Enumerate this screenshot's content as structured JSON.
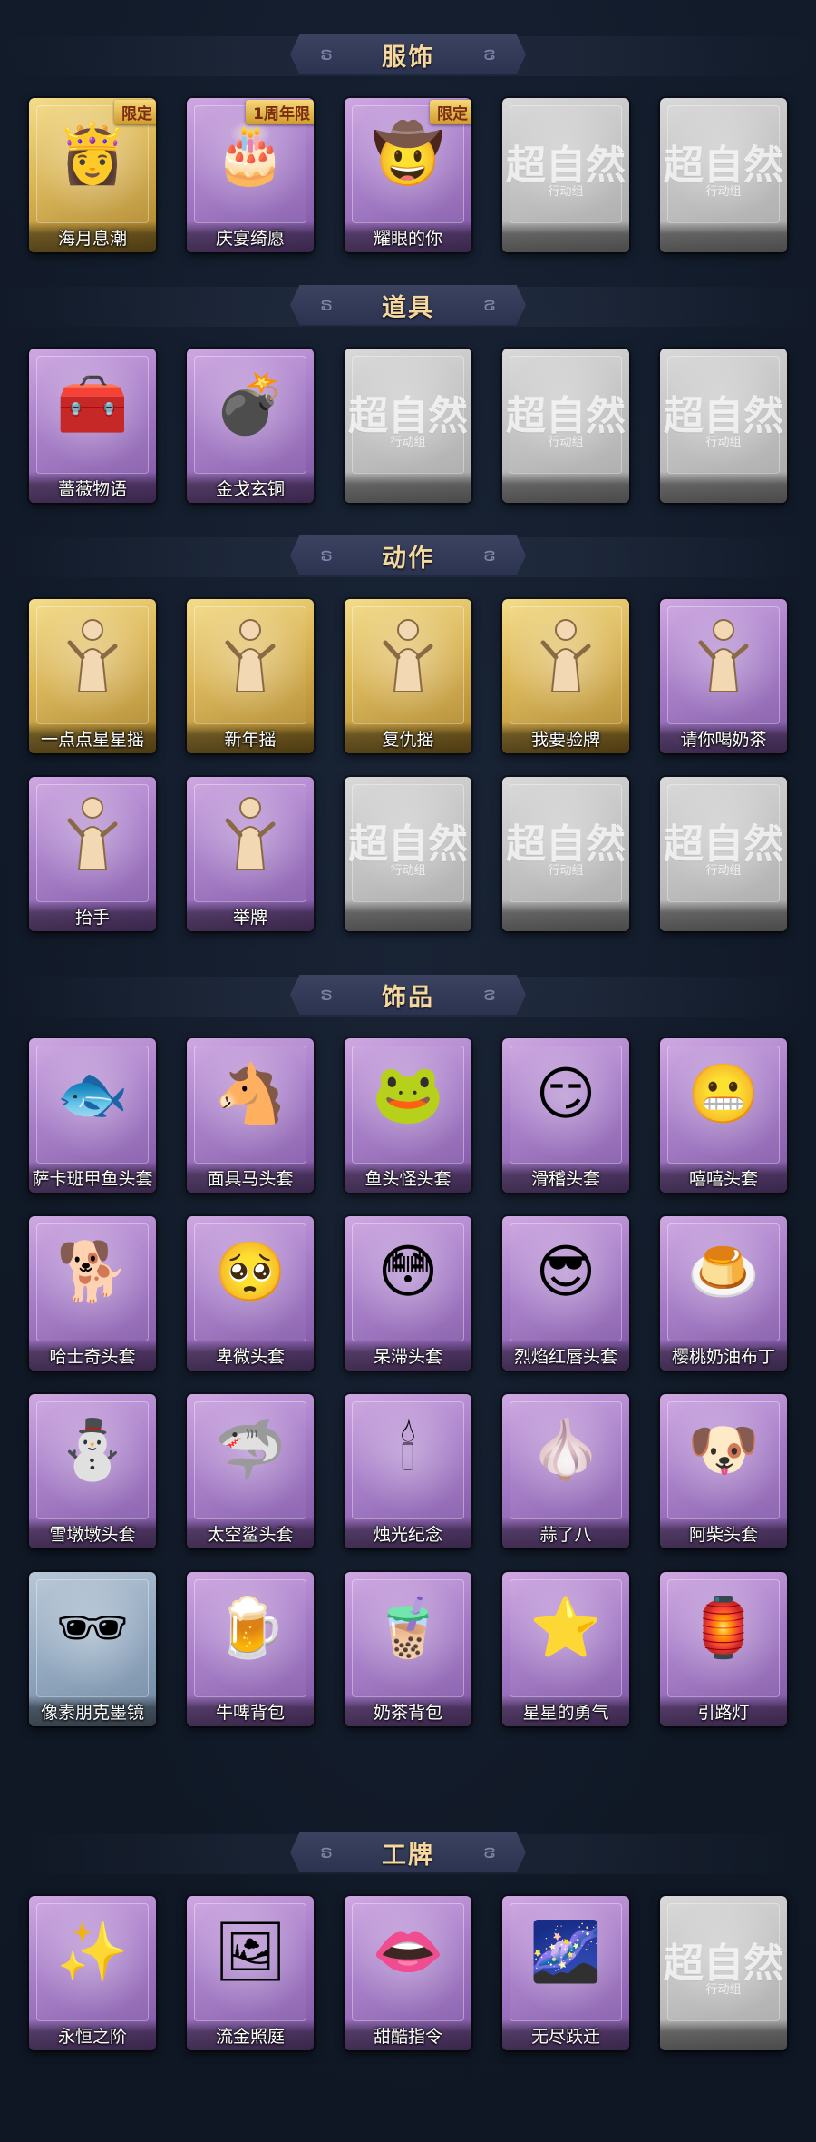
{
  "colors": {
    "background": "#111a28",
    "banner": "#323a57",
    "banner_text": "#f5d7a0",
    "card_purple": "#a57bc7",
    "card_gold": "#d9b454",
    "card_grey": "#bfbfbf",
    "card_blue": "#8ea5bd"
  },
  "placeholder": {
    "watermark": "超自然",
    "sub": "行动组"
  },
  "sections": [
    {
      "title": "服饰",
      "rows": [
        [
          {
            "label": "海月息潮",
            "style": "gold",
            "badge": "限定",
            "icon": "mermaid-portrait-icon",
            "glyph": "👸"
          },
          {
            "label": "庆宴绮愿",
            "style": "purple",
            "badge": "1周年限",
            "icon": "anniversary-portrait-icon",
            "glyph": "🎂"
          },
          {
            "label": "耀眼的你",
            "style": "purple",
            "badge": "限定",
            "icon": "cowgirl-portrait-icon",
            "glyph": "🤠"
          },
          {
            "label": "",
            "style": "grey",
            "placeholder": true
          },
          {
            "label": "",
            "style": "grey",
            "placeholder": true
          }
        ]
      ]
    },
    {
      "title": "道具",
      "rows": [
        [
          {
            "label": "蔷薇物语",
            "style": "purple",
            "icon": "first-aid-kit-icon",
            "glyph": "🧰"
          },
          {
            "label": "金戈玄铜",
            "style": "purple",
            "icon": "grenade-icon",
            "glyph": "💣"
          },
          {
            "label": "",
            "style": "grey",
            "placeholder": true
          },
          {
            "label": "",
            "style": "grey",
            "placeholder": true
          },
          {
            "label": "",
            "style": "grey",
            "placeholder": true
          }
        ]
      ]
    },
    {
      "title": "动作",
      "rows": [
        [
          {
            "label": "一点点星星摇",
            "style": "gold",
            "icon": "dance-pose-icon",
            "pose": true
          },
          {
            "label": "新年摇",
            "style": "gold",
            "icon": "dance-pose-icon",
            "pose": true
          },
          {
            "label": "复仇摇",
            "style": "gold",
            "icon": "dance-pose-icon",
            "pose": true
          },
          {
            "label": "我要验牌",
            "style": "gold",
            "icon": "card-pose-icon",
            "pose": true
          },
          {
            "label": "请你喝奶茶",
            "style": "purple",
            "icon": "tea-pose-icon",
            "pose": true
          }
        ],
        [
          {
            "label": "抬手",
            "style": "purple",
            "icon": "raise-hand-pose-icon",
            "pose": true
          },
          {
            "label": "举牌",
            "style": "purple",
            "icon": "hold-sign-pose-icon",
            "pose": true
          },
          {
            "label": "",
            "style": "grey",
            "placeholder": true
          },
          {
            "label": "",
            "style": "grey",
            "placeholder": true
          },
          {
            "label": "",
            "style": "grey",
            "placeholder": true
          }
        ]
      ]
    },
    {
      "title": "饰品",
      "rows": [
        [
          {
            "label": "萨卡班甲鱼头套",
            "style": "purple",
            "icon": "fish-head-icon",
            "glyph": "🐟"
          },
          {
            "label": "面具马头套",
            "style": "purple",
            "icon": "horse-head-icon",
            "glyph": "🐴"
          },
          {
            "label": "鱼头怪头套",
            "style": "purple",
            "icon": "frog-fish-head-icon",
            "glyph": "🐸"
          },
          {
            "label": "滑稽头套",
            "style": "purple",
            "icon": "funny-face-icon",
            "glyph": "😏"
          },
          {
            "label": "嘻嘻头套",
            "style": "purple",
            "icon": "grin-face-icon",
            "glyph": "😬"
          }
        ],
        [
          {
            "label": "哈士奇头套",
            "style": "purple",
            "icon": "husky-head-icon",
            "glyph": "🐕"
          },
          {
            "label": "卑微头套",
            "style": "purple",
            "icon": "humble-face-icon",
            "glyph": "🥺"
          },
          {
            "label": "呆滞头套",
            "style": "purple",
            "icon": "dazed-face-icon",
            "glyph": "😳"
          },
          {
            "label": "烈焰红唇头套",
            "style": "purple",
            "icon": "pikachu-head-icon",
            "glyph": "😎"
          },
          {
            "label": "樱桃奶油布丁",
            "style": "purple",
            "icon": "pudding-icon",
            "glyph": "🍮"
          }
        ],
        [
          {
            "label": "雪墩墩头套",
            "style": "purple",
            "icon": "snowman-head-icon",
            "glyph": "⛄"
          },
          {
            "label": "太空鲨头套",
            "style": "purple",
            "icon": "shark-head-icon",
            "glyph": "🦈"
          },
          {
            "label": "烛光纪念",
            "style": "purple",
            "icon": "candle-icon",
            "glyph": "🕯"
          },
          {
            "label": "蒜了八",
            "style": "purple",
            "icon": "garlic-icon",
            "glyph": "🧄"
          },
          {
            "label": "阿柴头套",
            "style": "purple",
            "icon": "shiba-head-icon",
            "glyph": "🐶"
          }
        ],
        [
          {
            "label": "像素朋克墨镜",
            "style": "blue",
            "icon": "pixel-sunglasses-icon",
            "glyph": "🕶"
          },
          {
            "label": "牛啤背包",
            "style": "purple",
            "icon": "beer-backpack-icon",
            "glyph": "🍺"
          },
          {
            "label": "奶茶背包",
            "style": "purple",
            "icon": "milk-tea-backpack-icon",
            "glyph": "🧋"
          },
          {
            "label": "星星的勇气",
            "style": "purple",
            "icon": "star-charm-icon",
            "glyph": "⭐"
          },
          {
            "label": "引路灯",
            "style": "purple",
            "icon": "lantern-icon",
            "glyph": "🏮"
          }
        ]
      ]
    },
    {
      "title": "工牌",
      "rows": [
        [
          {
            "label": "永恒之阶",
            "style": "purple",
            "icon": "golden-badge-icon",
            "glyph": "✨"
          },
          {
            "label": "流金照庭",
            "style": "purple",
            "icon": "frame-badge-icon",
            "glyph": "🖼"
          },
          {
            "label": "甜酷指令",
            "style": "purple",
            "icon": "pink-monster-badge-icon",
            "glyph": "👄"
          },
          {
            "label": "无尽跃迁",
            "style": "purple",
            "icon": "galaxy-card-badge-icon",
            "glyph": "🌌"
          },
          {
            "label": "",
            "style": "grey",
            "placeholder": true
          }
        ]
      ]
    }
  ]
}
